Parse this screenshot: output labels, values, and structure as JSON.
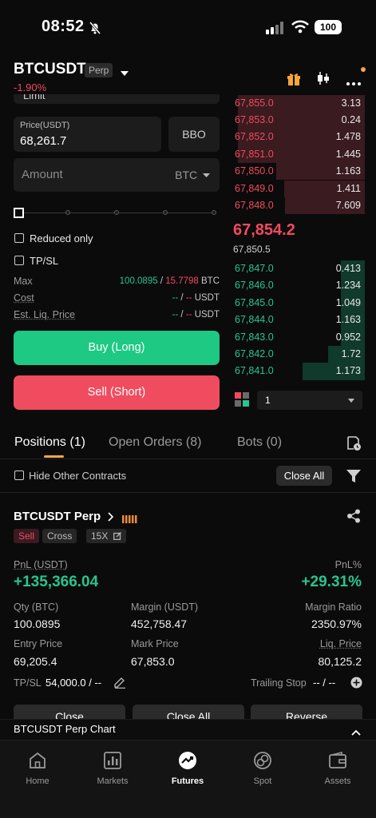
{
  "status_bar": {
    "time": "08:52",
    "battery": "100"
  },
  "header": {
    "symbol": "BTCUSDT",
    "badge": "Perp",
    "change": "-1.90%"
  },
  "order_form": {
    "partial_top_label": "Limit",
    "price_label": "Price(USDT)",
    "price_value": "68,261.7",
    "bbo_label": "BBO",
    "amount_placeholder": "Amount",
    "amount_unit": "BTC",
    "reduced_only": "Reduced only",
    "tpsl": "TP/SL",
    "max_label": "Max",
    "max_buy": "100.0895",
    "max_sell": "15.7798",
    "max_unit": "BTC",
    "cost_label": "Cost",
    "cost_value": "-- / --",
    "cost_unit": "USDT",
    "liq_label": "Est. Liq. Price",
    "liq_value": "-- / --",
    "liq_unit": "USDT",
    "buy_label": "Buy (Long)",
    "sell_label": "Sell (Short)"
  },
  "orderbook": {
    "asks": [
      {
        "price": "67,855.0",
        "qty": "3.13",
        "depth": 0.96
      },
      {
        "price": "67,853.0",
        "qty": "0.24",
        "depth": 0.96
      },
      {
        "price": "67,852.0",
        "qty": "1.478",
        "depth": 0.96
      },
      {
        "price": "67,851.0",
        "qty": "1.445",
        "depth": 0.96
      },
      {
        "price": "67,850.0",
        "qty": "1.163",
        "depth": 0.67
      },
      {
        "price": "67,849.0",
        "qty": "1.411",
        "depth": 0.61
      },
      {
        "price": "67,848.0",
        "qty": "7.609",
        "depth": 0.6
      }
    ],
    "last_price": "67,854.2",
    "mark_price": "67,850.5",
    "bids": [
      {
        "price": "67,847.0",
        "qty": "0.413",
        "depth": 0.18
      },
      {
        "price": "67,846.0",
        "qty": "1.234",
        "depth": 0.18
      },
      {
        "price": "67,845.0",
        "qty": "1.049",
        "depth": 0.18
      },
      {
        "price": "67,844.0",
        "qty": "1.163",
        "depth": 0.18
      },
      {
        "price": "67,843.0",
        "qty": "0.952",
        "depth": 0.18
      },
      {
        "price": "67,842.0",
        "qty": "1.72",
        "depth": 0.28
      },
      {
        "price": "67,841.0",
        "qty": "1.173",
        "depth": 0.47
      }
    ],
    "depth_value": "1"
  },
  "tabs": {
    "positions": "Positions (1)",
    "open_orders": "Open Orders (8)",
    "bots": "Bots (0)"
  },
  "filters": {
    "hide_other": "Hide Other Contracts",
    "close_all": "Close All"
  },
  "position": {
    "symbol": "BTCUSDT Perp",
    "side": "Sell",
    "mode": "Cross",
    "leverage": "15X",
    "pnl_label": "PnL (USDT)",
    "pnl_value": "+135,366.04",
    "pnlpct_label": "PnL%",
    "pnlpct_value": "+29.31%",
    "qty_label": "Qty (BTC)",
    "qty_value": "100.0895",
    "margin_label": "Margin (USDT)",
    "margin_value": "452,758.47",
    "ratio_label": "Margin Ratio",
    "ratio_value": "2350.97%",
    "entry_label": "Entry Price",
    "entry_value": "69,205.4",
    "mark_label": "Mark Price",
    "mark_value": "67,853.0",
    "liq_label": "Liq. Price",
    "liq_value": "80,125.2",
    "tpsl_label": "TP/SL",
    "tpsl_value": "54,000.0 / --",
    "trailing_label": "Trailing Stop",
    "trailing_value": "-- / --",
    "buttons": [
      "Close",
      "Close All",
      "Reverse"
    ]
  },
  "chart_bar": {
    "label": "BTCUSDT Perp Chart"
  },
  "nav": [
    {
      "label": "Home",
      "icon": "home-icon"
    },
    {
      "label": "Markets",
      "icon": "markets-icon"
    },
    {
      "label": "Futures",
      "icon": "futures-icon"
    },
    {
      "label": "Spot",
      "icon": "spot-icon"
    },
    {
      "label": "Assets",
      "icon": "assets-icon"
    }
  ]
}
